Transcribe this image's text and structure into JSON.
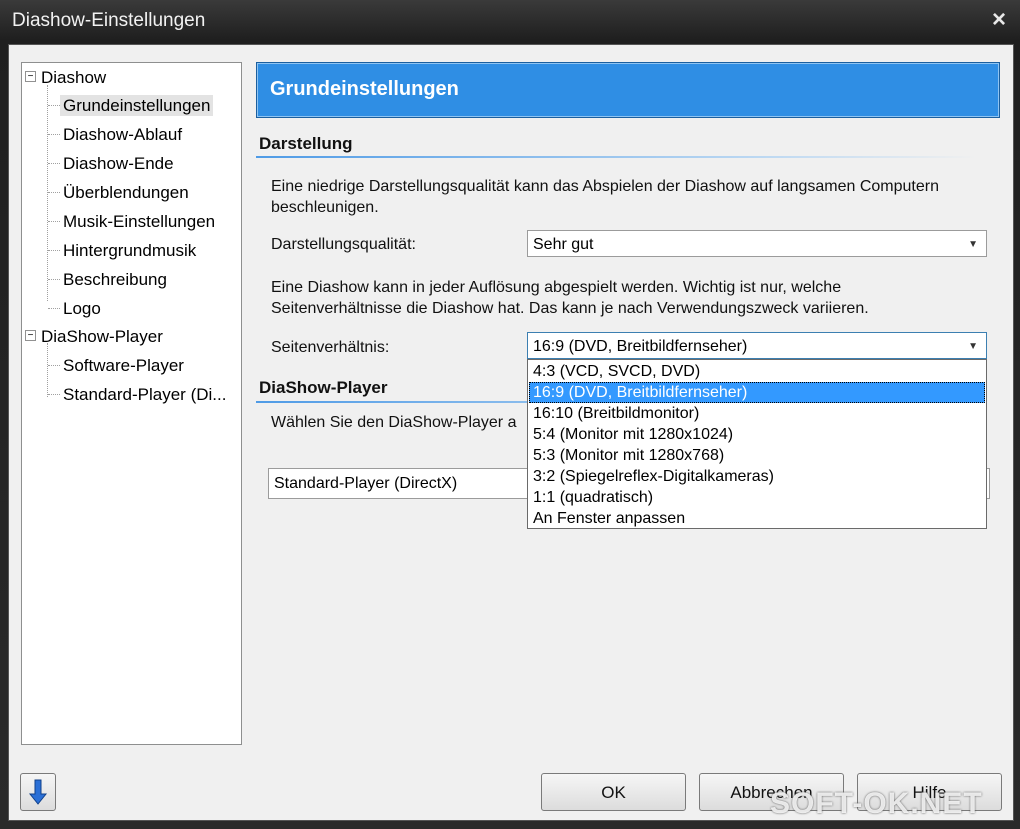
{
  "window": {
    "title": "Diashow-Einstellungen",
    "close": "×"
  },
  "tree": {
    "root1": "Diashow",
    "root1_items": [
      "Grundeinstellungen",
      "Diashow-Ablauf",
      "Diashow-Ende",
      "Überblendungen",
      "Musik-Einstellungen",
      "Hintergrundmusik",
      "Beschreibung",
      "Logo"
    ],
    "root2": "DiaShow-Player",
    "root2_items": [
      "Software-Player",
      "Standard-Player (Di..."
    ],
    "expander": "−"
  },
  "header": {
    "title": "Grundeinstellungen"
  },
  "darstellung": {
    "section": "Darstellung",
    "desc_line1": "Eine niedrige Darstellungsqualität kann das Abspielen der Diashow auf langsamen Computern",
    "desc_line2": "beschleunigen.",
    "quality_label": "Darstellungsqualität:",
    "quality_value": "Sehr gut",
    "res_line1": "Eine Diashow kann in jeder Auflösung abgespielt werden. Wichtig ist nur, welche",
    "res_line2": "Seitenverhältnisse die Diashow hat. Das kann je nach Verwendungszweck variieren.",
    "ratio_label": "Seitenverhältnis:",
    "ratio_value": "16:9 (DVD, Breitbildfernseher)",
    "ratio_options": [
      "4:3 (VCD, SVCD, DVD)",
      "16:9 (DVD, Breitbildfernseher)",
      "16:10 (Breitbildmonitor)",
      "5:4 (Monitor mit 1280x1024)",
      "5:3 (Monitor mit 1280x768)",
      "3:2 (Spiegelreflex-Digitalkameras)",
      "1:1 (quadratisch)",
      "An Fenster anpassen"
    ],
    "highlighted_index": 1
  },
  "player": {
    "section": "DiaShow-Player",
    "desc": "Wählen Sie den DiaShow-Player a",
    "player_value": "Standard-Player (DirectX)"
  },
  "buttons": {
    "ok": "OK",
    "cancel": "Abbrechen",
    "help": "Hilfe"
  },
  "watermark": "SOFT-OK.NET",
  "colors": {
    "header_bg": "#2f8ee4",
    "highlight": "#3399ff"
  }
}
